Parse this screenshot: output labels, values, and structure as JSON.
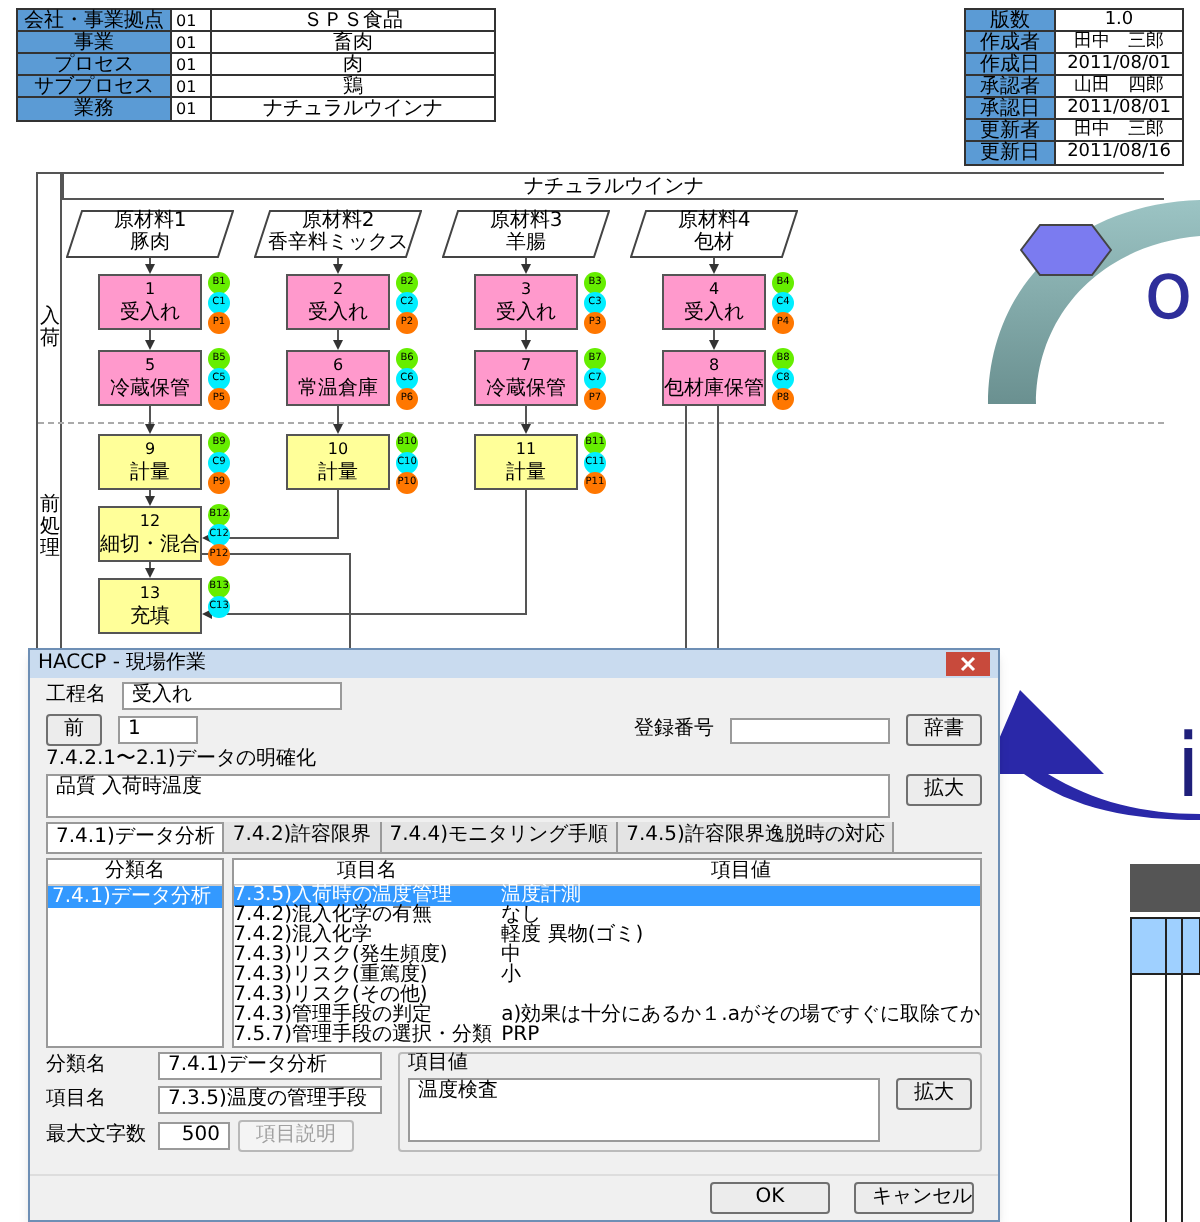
{
  "header_left": [
    {
      "label": "会社・事業拠点",
      "code": "01",
      "value": "ＳＰＳ食品"
    },
    {
      "label": "事業",
      "code": "01",
      "value": "畜肉"
    },
    {
      "label": "プロセス",
      "code": "01",
      "value": "肉"
    },
    {
      "label": "サブプロセス",
      "code": "01",
      "value": "鶏"
    },
    {
      "label": "業務",
      "code": "01",
      "value": "ナチュラルウインナ"
    }
  ],
  "header_right": [
    {
      "label": "版数",
      "value": "1.0"
    },
    {
      "label": "作成者",
      "value": "田中　三郎"
    },
    {
      "label": "作成日",
      "value": "2011/08/01"
    },
    {
      "label": "承認者",
      "value": "山田　四郎"
    },
    {
      "label": "承認日",
      "value": "2011/08/01"
    },
    {
      "label": "更新者",
      "value": "田中　三郎"
    },
    {
      "label": "更新日",
      "value": "2011/08/16"
    }
  ],
  "diagram": {
    "title": "ナチュラルウインナ",
    "lanes": [
      {
        "label": "入荷"
      },
      {
        "label": "前処理"
      }
    ],
    "inputs": [
      {
        "label": "原材料1",
        "name": "豚肉"
      },
      {
        "label": "原材料2",
        "name": "香辛料ミックス"
      },
      {
        "label": "原材料3",
        "name": "羊腸"
      },
      {
        "label": "原材料4",
        "name": "包材"
      }
    ],
    "steps": [
      {
        "number": "1",
        "name": "受入れ",
        "color": "#ff99cc",
        "badges": [
          {
            "label": "B1",
            "color": "#66ee00"
          },
          {
            "label": "C1",
            "color": "#00eeff"
          },
          {
            "label": "P1",
            "color": "#ff7700"
          }
        ]
      },
      {
        "number": "2",
        "name": "受入れ",
        "color": "#ff99cc",
        "badges": [
          {
            "label": "B2",
            "color": "#66ee00"
          },
          {
            "label": "C2",
            "color": "#00eeff"
          },
          {
            "label": "P2",
            "color": "#ff7700"
          }
        ]
      },
      {
        "number": "3",
        "name": "受入れ",
        "color": "#ff99cc",
        "badges": [
          {
            "label": "B3",
            "color": "#66ee00"
          },
          {
            "label": "C3",
            "color": "#00eeff"
          },
          {
            "label": "P3",
            "color": "#ff7700"
          }
        ]
      },
      {
        "number": "4",
        "name": "受入れ",
        "color": "#ff99cc",
        "badges": [
          {
            "label": "B4",
            "color": "#66ee00"
          },
          {
            "label": "C4",
            "color": "#00eeff"
          },
          {
            "label": "P4",
            "color": "#ff7700"
          }
        ]
      },
      {
        "number": "5",
        "name": "冷蔵保管",
        "color": "#ff99cc",
        "badges": [
          {
            "label": "B5",
            "color": "#66ee00"
          },
          {
            "label": "C5",
            "color": "#00eeff"
          },
          {
            "label": "P5",
            "color": "#ff7700"
          }
        ]
      },
      {
        "number": "6",
        "name": "常温倉庫",
        "color": "#ff99cc",
        "badges": [
          {
            "label": "B6",
            "color": "#66ee00"
          },
          {
            "label": "C6",
            "color": "#00eeff"
          },
          {
            "label": "P6",
            "color": "#ff7700"
          }
        ]
      },
      {
        "number": "7",
        "name": "冷蔵保管",
        "color": "#ff99cc",
        "badges": [
          {
            "label": "B7",
            "color": "#66ee00"
          },
          {
            "label": "C7",
            "color": "#00eeff"
          },
          {
            "label": "P7",
            "color": "#ff7700"
          }
        ]
      },
      {
        "number": "8",
        "name": "包材庫保管",
        "color": "#ff99cc",
        "badges": [
          {
            "label": "B8",
            "color": "#66ee00"
          },
          {
            "label": "C8",
            "color": "#00eeff"
          },
          {
            "label": "P8",
            "color": "#ff7700"
          }
        ]
      },
      {
        "number": "9",
        "name": "計量",
        "color": "#ffff99",
        "badges": [
          {
            "label": "B9",
            "color": "#66ee00"
          },
          {
            "label": "C9",
            "color": "#00eeff"
          },
          {
            "label": "P9",
            "color": "#ff7700"
          }
        ]
      },
      {
        "number": "10",
        "name": "計量",
        "color": "#ffff99",
        "badges": [
          {
            "label": "B10",
            "color": "#66ee00"
          },
          {
            "label": "C10",
            "color": "#00eeff"
          },
          {
            "label": "P10",
            "color": "#ff7700"
          }
        ]
      },
      {
        "number": "11",
        "name": "計量",
        "color": "#ffff99",
        "badges": [
          {
            "label": "B11",
            "color": "#66ee00"
          },
          {
            "label": "C11",
            "color": "#00eeff"
          },
          {
            "label": "P11",
            "color": "#ff7700"
          }
        ]
      },
      {
        "number": "12",
        "name": "細切・混合",
        "color": "#ffff99",
        "badges": [
          {
            "label": "B12",
            "color": "#66ee00"
          },
          {
            "label": "C12",
            "color": "#00eeff"
          },
          {
            "label": "P12",
            "color": "#ff7700"
          }
        ]
      },
      {
        "number": "13",
        "name": "充填",
        "color": "#ffff99",
        "badges": [
          {
            "label": "B13",
            "color": "#66ee00"
          },
          {
            "label": "C13",
            "color": "#00eeff"
          }
        ]
      }
    ]
  },
  "dialog": {
    "title": "HACCP - 現場作業",
    "process_label": "工程名",
    "process_value": "受入れ",
    "prev_button": "前",
    "number_value": "1",
    "record_label": "登録番号",
    "dictionary_button": "辞書",
    "section_label": "7.4.2.1〜2.1)データの明確化",
    "note_value": "品質 入荷時温度",
    "expand_button": "拡大",
    "tabs": [
      {
        "label": "7.4.1)データ分析",
        "selected": true
      },
      {
        "label": "7.4.2)許容限界",
        "selected": false
      },
      {
        "label": "7.4.4)モニタリング手順",
        "selected": false
      },
      {
        "label": "7.4.5)許容限界逸脱時の対応",
        "selected": false
      }
    ],
    "category_list": {
      "header": "分類名",
      "items": [
        {
          "label": "7.4.1)データ分析",
          "selected": true
        }
      ]
    },
    "item_list": {
      "columns": [
        "項目名",
        "項目値"
      ],
      "rows": [
        {
          "name": "7.3.5)入荷時の温度管理",
          "value": "温度計測",
          "selected": true
        },
        {
          "name": "7.4.2)混入化学の有無",
          "value": "なし",
          "selected": false
        },
        {
          "name": "7.4.2)混入化学",
          "value": "軽度 異物(ゴミ)",
          "selected": false
        },
        {
          "name": "7.4.3)リスク(発生頻度)",
          "value": "中",
          "selected": false
        },
        {
          "name": "7.4.3)リスク(重篤度)",
          "value": "小",
          "selected": false
        },
        {
          "name": "7.4.3)リスク(その他)",
          "selected": false
        },
        {
          "name": "7.4.3)管理手段の判定",
          "value": "a)効果は十分にあるか１.aがその場ですぐに取除てか",
          "selected": false
        },
        {
          "name": "7.5.7)管理手段の選択・分類",
          "value": "PRP",
          "selected": false
        }
      ]
    },
    "category_label": "分類名",
    "category_value": "7.4.1)データ分析",
    "item_label": "項目名",
    "item_value": "7.3.5)温度の管理手段",
    "max_label": "最大文字数",
    "max_value": "500",
    "help_button": {
      "label": "項目説明",
      "disabled": true
    },
    "value_group_label": "項目値",
    "value_text": "温度検査",
    "value_expand_button": "拡大",
    "ok_button": "OK",
    "cancel_button": "キャンセル"
  },
  "graphics": {
    "upper_letter": "o",
    "lower_letter": "i"
  }
}
